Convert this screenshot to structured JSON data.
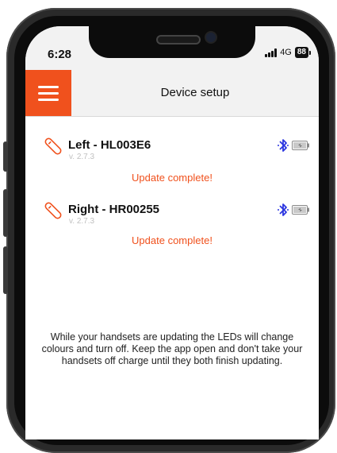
{
  "status_bar": {
    "time": "6:28",
    "network": "4G",
    "battery_level": "88"
  },
  "header": {
    "menu_icon": "hamburger-icon",
    "title": "Device setup"
  },
  "devices": [
    {
      "name": "Left - HL003E6",
      "version": "v. 2.7.3",
      "status": "Update complete!",
      "icons": [
        "handset-icon",
        "bluetooth-icon",
        "battery-charging-icon"
      ]
    },
    {
      "name": "Right - HR00255",
      "version": "v. 2.7.3",
      "status": "Update complete!",
      "icons": [
        "handset-icon",
        "bluetooth-icon",
        "battery-charging-icon"
      ]
    }
  ],
  "info": {
    "message": "While your handsets are updating the LEDs will change colours and turn off. Keep the app open and don't take your handsets off charge until they both finish updating."
  },
  "colors": {
    "accent": "#f0511d",
    "bluetooth": "#2b35e0"
  }
}
